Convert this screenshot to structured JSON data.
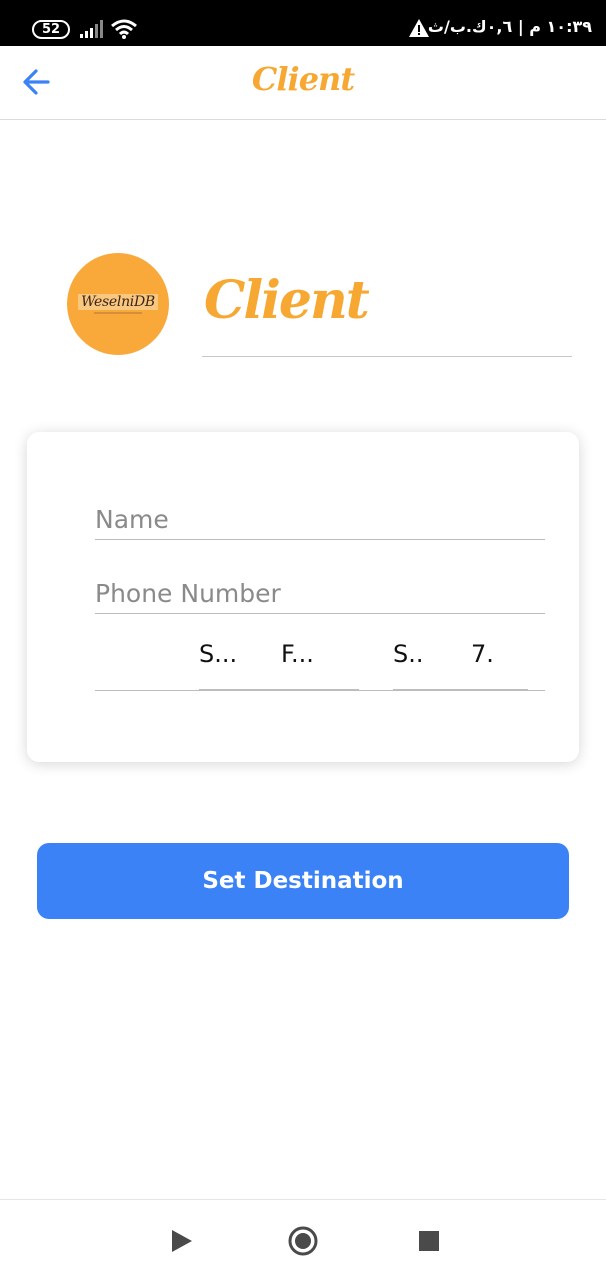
{
  "status_bar": {
    "battery": "52",
    "time": "١٠:٣٩ م | ٠,٦ك.ب/ث",
    "icons": [
      "battery-icon",
      "signal-icon",
      "wifi-icon",
      "warning-icon"
    ]
  },
  "app_bar": {
    "title": "Client",
    "back_icon": "arrow-left-icon"
  },
  "header": {
    "logo_text": "WeselniDB",
    "heading": "Client"
  },
  "form": {
    "name_placeholder": "Name",
    "phone_placeholder": "Phone Number",
    "picker_a": {
      "part1": "S...",
      "part2": "F..."
    },
    "picker_b": {
      "part1": "S..",
      "part2": "7."
    }
  },
  "actions": {
    "set_destination_label": "Set Destination"
  },
  "colors": {
    "accent": "#3b82f6",
    "brand": "#f6a832",
    "back_arrow": "#3b82f6"
  }
}
